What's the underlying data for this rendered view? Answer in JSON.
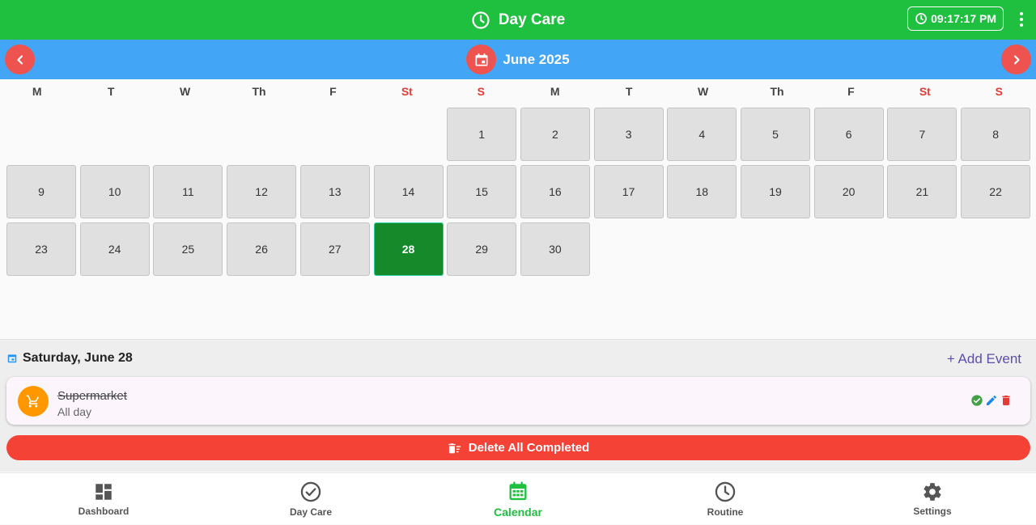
{
  "header": {
    "title": "Day Care",
    "time": "09:17:17 PM",
    "bar_color": "#1fbf3f"
  },
  "month_bar": {
    "label": "June 2025",
    "bar_color": "#42a5f5",
    "button_color": "#ef5350"
  },
  "weekdays": [
    {
      "label": "M",
      "weekend": false
    },
    {
      "label": "T",
      "weekend": false
    },
    {
      "label": "W",
      "weekend": false
    },
    {
      "label": "Th",
      "weekend": false
    },
    {
      "label": "F",
      "weekend": false
    },
    {
      "label": "St",
      "weekend": true
    },
    {
      "label": "S",
      "weekend": true
    },
    {
      "label": "M",
      "weekend": false
    },
    {
      "label": "T",
      "weekend": false
    },
    {
      "label": "W",
      "weekend": false
    },
    {
      "label": "Th",
      "weekend": false
    },
    {
      "label": "F",
      "weekend": false
    },
    {
      "label": "St",
      "weekend": true
    },
    {
      "label": "S",
      "weekend": true
    }
  ],
  "calendar": {
    "days_in_month": 30,
    "first_day_column": 7,
    "selected_day": 28
  },
  "selected_date": {
    "heading": "Saturday, June 28",
    "add_event_label": "+ Add Event"
  },
  "events": [
    {
      "title": "Supermarket",
      "subtitle": "All day",
      "icon": "cart-icon",
      "completed": true
    }
  ],
  "delete_completed_label": "Delete All Completed",
  "bottom_nav": [
    {
      "label": "Dashboard",
      "icon": "dashboard-icon",
      "active": false
    },
    {
      "label": "Day Care",
      "icon": "check-circle-icon",
      "active": false
    },
    {
      "label": "Calendar",
      "icon": "calendar-icon",
      "active": true
    },
    {
      "label": "Routine",
      "icon": "clock-icon",
      "active": false
    },
    {
      "label": "Settings",
      "icon": "gear-icon",
      "active": false
    }
  ]
}
